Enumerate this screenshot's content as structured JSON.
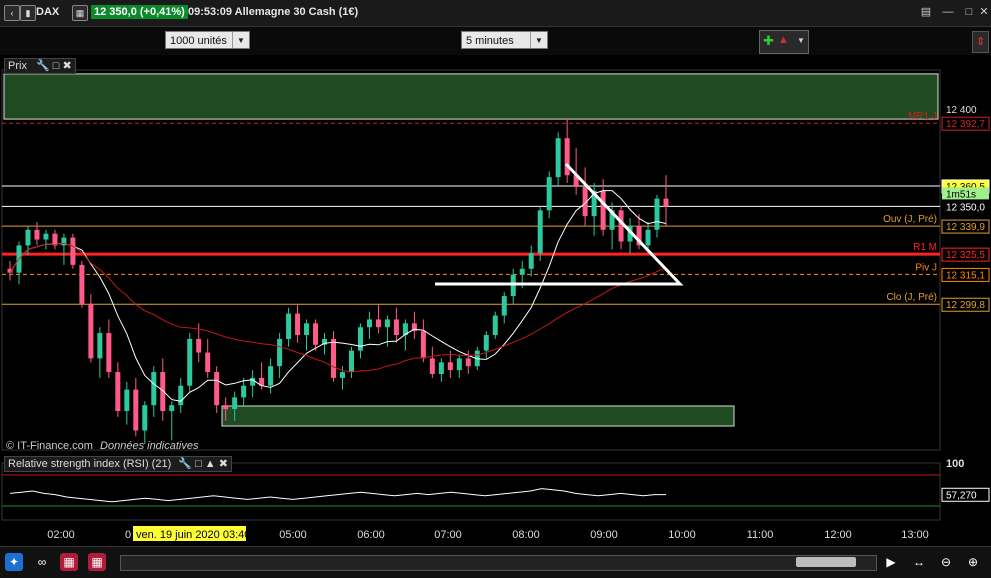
{
  "titlebar": {
    "ticker": "DAX",
    "price_badge": "12 350,0 (+0,41%)",
    "time_and_name": "09:53:09 Allemagne 30 Cash (1€)"
  },
  "toolbar": {
    "units_select": "1000 unités",
    "period_select": "5 minutes"
  },
  "price_pane": {
    "label": "Prix",
    "copyright": "© IT-Finance.com",
    "disclaimer": "Données indicatives",
    "levels": [
      {
        "name": "MR1 J",
        "value": "12 392,7",
        "price": 12392.7,
        "color": "#d02020",
        "style": "dashed"
      },
      {
        "name": "",
        "value": "12 360,5",
        "price": 12360.5,
        "color": "#ffffff",
        "style": "solid",
        "highlight": "#ffff33"
      },
      {
        "name": "Ouv (J, Pré)",
        "value": "12 339,9",
        "price": 12339.9,
        "color": "#e0a030",
        "style": "solid"
      },
      {
        "name": "R1 M",
        "value": "12 325,5",
        "price": 12325.5,
        "color": "#ff2222",
        "style": "thick"
      },
      {
        "name": "Piv J",
        "value": "12 315,1",
        "price": 12315.1,
        "color": "#ff8800",
        "style": "dashed"
      },
      {
        "name": "Clo (J, Pré)",
        "value": "12 299,8",
        "price": 12299.8,
        "color": "#e0a030",
        "style": "solid"
      }
    ],
    "axis_ticks": [
      "12 400",
      "12 350,0"
    ],
    "countdown": "1m51s",
    "current_price": 12350.0
  },
  "rsi_pane": {
    "label": "Relative strength index (RSI) (21)",
    "axis_top": "100",
    "value": "57,270"
  },
  "time_axis": {
    "labels": [
      "02:00",
      "0",
      "05:00",
      "06:00",
      "07:00",
      "08:00",
      "09:00",
      "10:00",
      "11:00",
      "12:00",
      "13:00"
    ],
    "cursor_label": "ven. 19 juin 2020 03:40"
  },
  "colors": {
    "up_candle": "#2cc9a0",
    "down_candle": "#ff5a8a",
    "green_zone": "#1f4a22",
    "ma_fast": "#ffffff",
    "ma_slow": "#c01818",
    "price_badge": "#0a8a2a"
  },
  "chart_data": {
    "type": "candlestick",
    "ylim": [
      12225,
      12420
    ],
    "candles": [
      [
        12318,
        12322,
        12312,
        12316
      ],
      [
        12316,
        12332,
        12310,
        12330
      ],
      [
        12330,
        12340,
        12325,
        12338
      ],
      [
        12338,
        12342,
        12330,
        12333
      ],
      [
        12333,
        12338,
        12328,
        12336
      ],
      [
        12336,
        12338,
        12328,
        12330
      ],
      [
        12330,
        12336,
        12320,
        12334
      ],
      [
        12334,
        12336,
        12318,
        12320
      ],
      [
        12320,
        12322,
        12298,
        12300
      ],
      [
        12300,
        12305,
        12270,
        12272
      ],
      [
        12272,
        12288,
        12262,
        12285
      ],
      [
        12285,
        12292,
        12262,
        12265
      ],
      [
        12265,
        12270,
        12242,
        12245
      ],
      [
        12245,
        12260,
        12238,
        12256
      ],
      [
        12256,
        12262,
        12232,
        12235
      ],
      [
        12235,
        12250,
        12228,
        12248
      ],
      [
        12248,
        12268,
        12242,
        12265
      ],
      [
        12265,
        12272,
        12240,
        12245
      ],
      [
        12245,
        12250,
        12230,
        12248
      ],
      [
        12248,
        12262,
        12244,
        12258
      ],
      [
        12258,
        12285,
        12255,
        12282
      ],
      [
        12282,
        12290,
        12270,
        12275
      ],
      [
        12275,
        12282,
        12262,
        12265
      ],
      [
        12265,
        12268,
        12244,
        12248
      ],
      [
        12248,
        12252,
        12240,
        12246
      ],
      [
        12246,
        12255,
        12240,
        12252
      ],
      [
        12252,
        12262,
        12248,
        12258
      ],
      [
        12258,
        12266,
        12252,
        12262
      ],
      [
        12262,
        12270,
        12256,
        12258
      ],
      [
        12258,
        12272,
        12254,
        12268
      ],
      [
        12268,
        12285,
        12262,
        12282
      ],
      [
        12282,
        12298,
        12278,
        12295
      ],
      [
        12295,
        12300,
        12280,
        12284
      ],
      [
        12284,
        12292,
        12276,
        12290
      ],
      [
        12290,
        12292,
        12276,
        12279
      ],
      [
        12279,
        12285,
        12274,
        12282
      ],
      [
        12282,
        12286,
        12260,
        12262
      ],
      [
        12262,
        12268,
        12256,
        12265
      ],
      [
        12265,
        12278,
        12262,
        12276
      ],
      [
        12276,
        12290,
        12272,
        12288
      ],
      [
        12288,
        12296,
        12282,
        12292
      ],
      [
        12292,
        12300,
        12285,
        12288
      ],
      [
        12288,
        12294,
        12278,
        12292
      ],
      [
        12292,
        12298,
        12280,
        12284
      ],
      [
        12284,
        12292,
        12276,
        12290
      ],
      [
        12290,
        12296,
        12282,
        12286
      ],
      [
        12286,
        12292,
        12270,
        12272
      ],
      [
        12272,
        12278,
        12262,
        12264
      ],
      [
        12264,
        12272,
        12260,
        12270
      ],
      [
        12270,
        12276,
        12262,
        12266
      ],
      [
        12266,
        12274,
        12262,
        12272
      ],
      [
        12272,
        12276,
        12264,
        12268
      ],
      [
        12268,
        12278,
        12266,
        12276
      ],
      [
        12276,
        12286,
        12272,
        12284
      ],
      [
        12284,
        12296,
        12282,
        12294
      ],
      [
        12294,
        12306,
        12290,
        12304
      ],
      [
        12304,
        12318,
        12300,
        12315
      ],
      [
        12315,
        12322,
        12308,
        12318
      ],
      [
        12318,
        12330,
        12314,
        12326
      ],
      [
        12326,
        12350,
        12322,
        12348
      ],
      [
        12348,
        12368,
        12344,
        12365
      ],
      [
        12365,
        12388,
        12360,
        12385
      ],
      [
        12385,
        12395,
        12362,
        12366
      ],
      [
        12366,
        12380,
        12356,
        12360
      ],
      [
        12360,
        12370,
        12340,
        12345
      ],
      [
        12345,
        12362,
        12335,
        12358
      ],
      [
        12358,
        12364,
        12335,
        12338
      ],
      [
        12338,
        12352,
        12328,
        12348
      ],
      [
        12348,
        12350,
        12328,
        12332
      ],
      [
        12332,
        12344,
        12326,
        12340
      ],
      [
        12340,
        12346,
        12328,
        12330
      ],
      [
        12330,
        12342,
        12326,
        12338
      ],
      [
        12338,
        12356,
        12334,
        12354
      ],
      [
        12354,
        12366,
        12340,
        12350
      ]
    ],
    "rsi": [
      58,
      59,
      60,
      58,
      57,
      55,
      54,
      53,
      52,
      51,
      52,
      53,
      54,
      53,
      52,
      53,
      54,
      55,
      56,
      55,
      54,
      53,
      54,
      55,
      54,
      53,
      54,
      55,
      56,
      57,
      58,
      59,
      58,
      57,
      56,
      57,
      58,
      57,
      58,
      59,
      58,
      57,
      56,
      57,
      58,
      59,
      60,
      62,
      61,
      60,
      58,
      57,
      56,
      57,
      58,
      57,
      56,
      57,
      57
    ]
  }
}
